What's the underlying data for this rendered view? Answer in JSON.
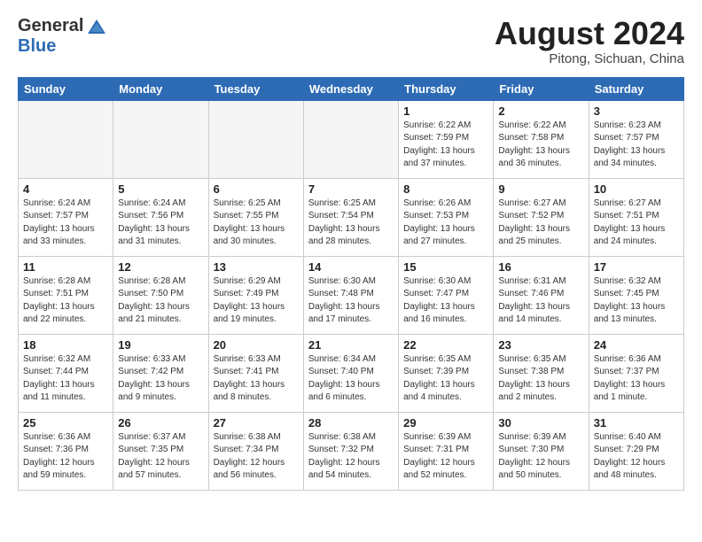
{
  "header": {
    "logo_general": "General",
    "logo_blue": "Blue",
    "month_year": "August 2024",
    "location": "Pitong, Sichuan, China"
  },
  "weekdays": [
    "Sunday",
    "Monday",
    "Tuesday",
    "Wednesday",
    "Thursday",
    "Friday",
    "Saturday"
  ],
  "weeks": [
    [
      {
        "day": "",
        "detail": ""
      },
      {
        "day": "",
        "detail": ""
      },
      {
        "day": "",
        "detail": ""
      },
      {
        "day": "",
        "detail": ""
      },
      {
        "day": "1",
        "detail": "Sunrise: 6:22 AM\nSunset: 7:59 PM\nDaylight: 13 hours\nand 37 minutes."
      },
      {
        "day": "2",
        "detail": "Sunrise: 6:22 AM\nSunset: 7:58 PM\nDaylight: 13 hours\nand 36 minutes."
      },
      {
        "day": "3",
        "detail": "Sunrise: 6:23 AM\nSunset: 7:57 PM\nDaylight: 13 hours\nand 34 minutes."
      }
    ],
    [
      {
        "day": "4",
        "detail": "Sunrise: 6:24 AM\nSunset: 7:57 PM\nDaylight: 13 hours\nand 33 minutes."
      },
      {
        "day": "5",
        "detail": "Sunrise: 6:24 AM\nSunset: 7:56 PM\nDaylight: 13 hours\nand 31 minutes."
      },
      {
        "day": "6",
        "detail": "Sunrise: 6:25 AM\nSunset: 7:55 PM\nDaylight: 13 hours\nand 30 minutes."
      },
      {
        "day": "7",
        "detail": "Sunrise: 6:25 AM\nSunset: 7:54 PM\nDaylight: 13 hours\nand 28 minutes."
      },
      {
        "day": "8",
        "detail": "Sunrise: 6:26 AM\nSunset: 7:53 PM\nDaylight: 13 hours\nand 27 minutes."
      },
      {
        "day": "9",
        "detail": "Sunrise: 6:27 AM\nSunset: 7:52 PM\nDaylight: 13 hours\nand 25 minutes."
      },
      {
        "day": "10",
        "detail": "Sunrise: 6:27 AM\nSunset: 7:51 PM\nDaylight: 13 hours\nand 24 minutes."
      }
    ],
    [
      {
        "day": "11",
        "detail": "Sunrise: 6:28 AM\nSunset: 7:51 PM\nDaylight: 13 hours\nand 22 minutes."
      },
      {
        "day": "12",
        "detail": "Sunrise: 6:28 AM\nSunset: 7:50 PM\nDaylight: 13 hours\nand 21 minutes."
      },
      {
        "day": "13",
        "detail": "Sunrise: 6:29 AM\nSunset: 7:49 PM\nDaylight: 13 hours\nand 19 minutes."
      },
      {
        "day": "14",
        "detail": "Sunrise: 6:30 AM\nSunset: 7:48 PM\nDaylight: 13 hours\nand 17 minutes."
      },
      {
        "day": "15",
        "detail": "Sunrise: 6:30 AM\nSunset: 7:47 PM\nDaylight: 13 hours\nand 16 minutes."
      },
      {
        "day": "16",
        "detail": "Sunrise: 6:31 AM\nSunset: 7:46 PM\nDaylight: 13 hours\nand 14 minutes."
      },
      {
        "day": "17",
        "detail": "Sunrise: 6:32 AM\nSunset: 7:45 PM\nDaylight: 13 hours\nand 13 minutes."
      }
    ],
    [
      {
        "day": "18",
        "detail": "Sunrise: 6:32 AM\nSunset: 7:44 PM\nDaylight: 13 hours\nand 11 minutes."
      },
      {
        "day": "19",
        "detail": "Sunrise: 6:33 AM\nSunset: 7:42 PM\nDaylight: 13 hours\nand 9 minutes."
      },
      {
        "day": "20",
        "detail": "Sunrise: 6:33 AM\nSunset: 7:41 PM\nDaylight: 13 hours\nand 8 minutes."
      },
      {
        "day": "21",
        "detail": "Sunrise: 6:34 AM\nSunset: 7:40 PM\nDaylight: 13 hours\nand 6 minutes."
      },
      {
        "day": "22",
        "detail": "Sunrise: 6:35 AM\nSunset: 7:39 PM\nDaylight: 13 hours\nand 4 minutes."
      },
      {
        "day": "23",
        "detail": "Sunrise: 6:35 AM\nSunset: 7:38 PM\nDaylight: 13 hours\nand 2 minutes."
      },
      {
        "day": "24",
        "detail": "Sunrise: 6:36 AM\nSunset: 7:37 PM\nDaylight: 13 hours\nand 1 minute."
      }
    ],
    [
      {
        "day": "25",
        "detail": "Sunrise: 6:36 AM\nSunset: 7:36 PM\nDaylight: 12 hours\nand 59 minutes."
      },
      {
        "day": "26",
        "detail": "Sunrise: 6:37 AM\nSunset: 7:35 PM\nDaylight: 12 hours\nand 57 minutes."
      },
      {
        "day": "27",
        "detail": "Sunrise: 6:38 AM\nSunset: 7:34 PM\nDaylight: 12 hours\nand 56 minutes."
      },
      {
        "day": "28",
        "detail": "Sunrise: 6:38 AM\nSunset: 7:32 PM\nDaylight: 12 hours\nand 54 minutes."
      },
      {
        "day": "29",
        "detail": "Sunrise: 6:39 AM\nSunset: 7:31 PM\nDaylight: 12 hours\nand 52 minutes."
      },
      {
        "day": "30",
        "detail": "Sunrise: 6:39 AM\nSunset: 7:30 PM\nDaylight: 12 hours\nand 50 minutes."
      },
      {
        "day": "31",
        "detail": "Sunrise: 6:40 AM\nSunset: 7:29 PM\nDaylight: 12 hours\nand 48 minutes."
      }
    ]
  ]
}
